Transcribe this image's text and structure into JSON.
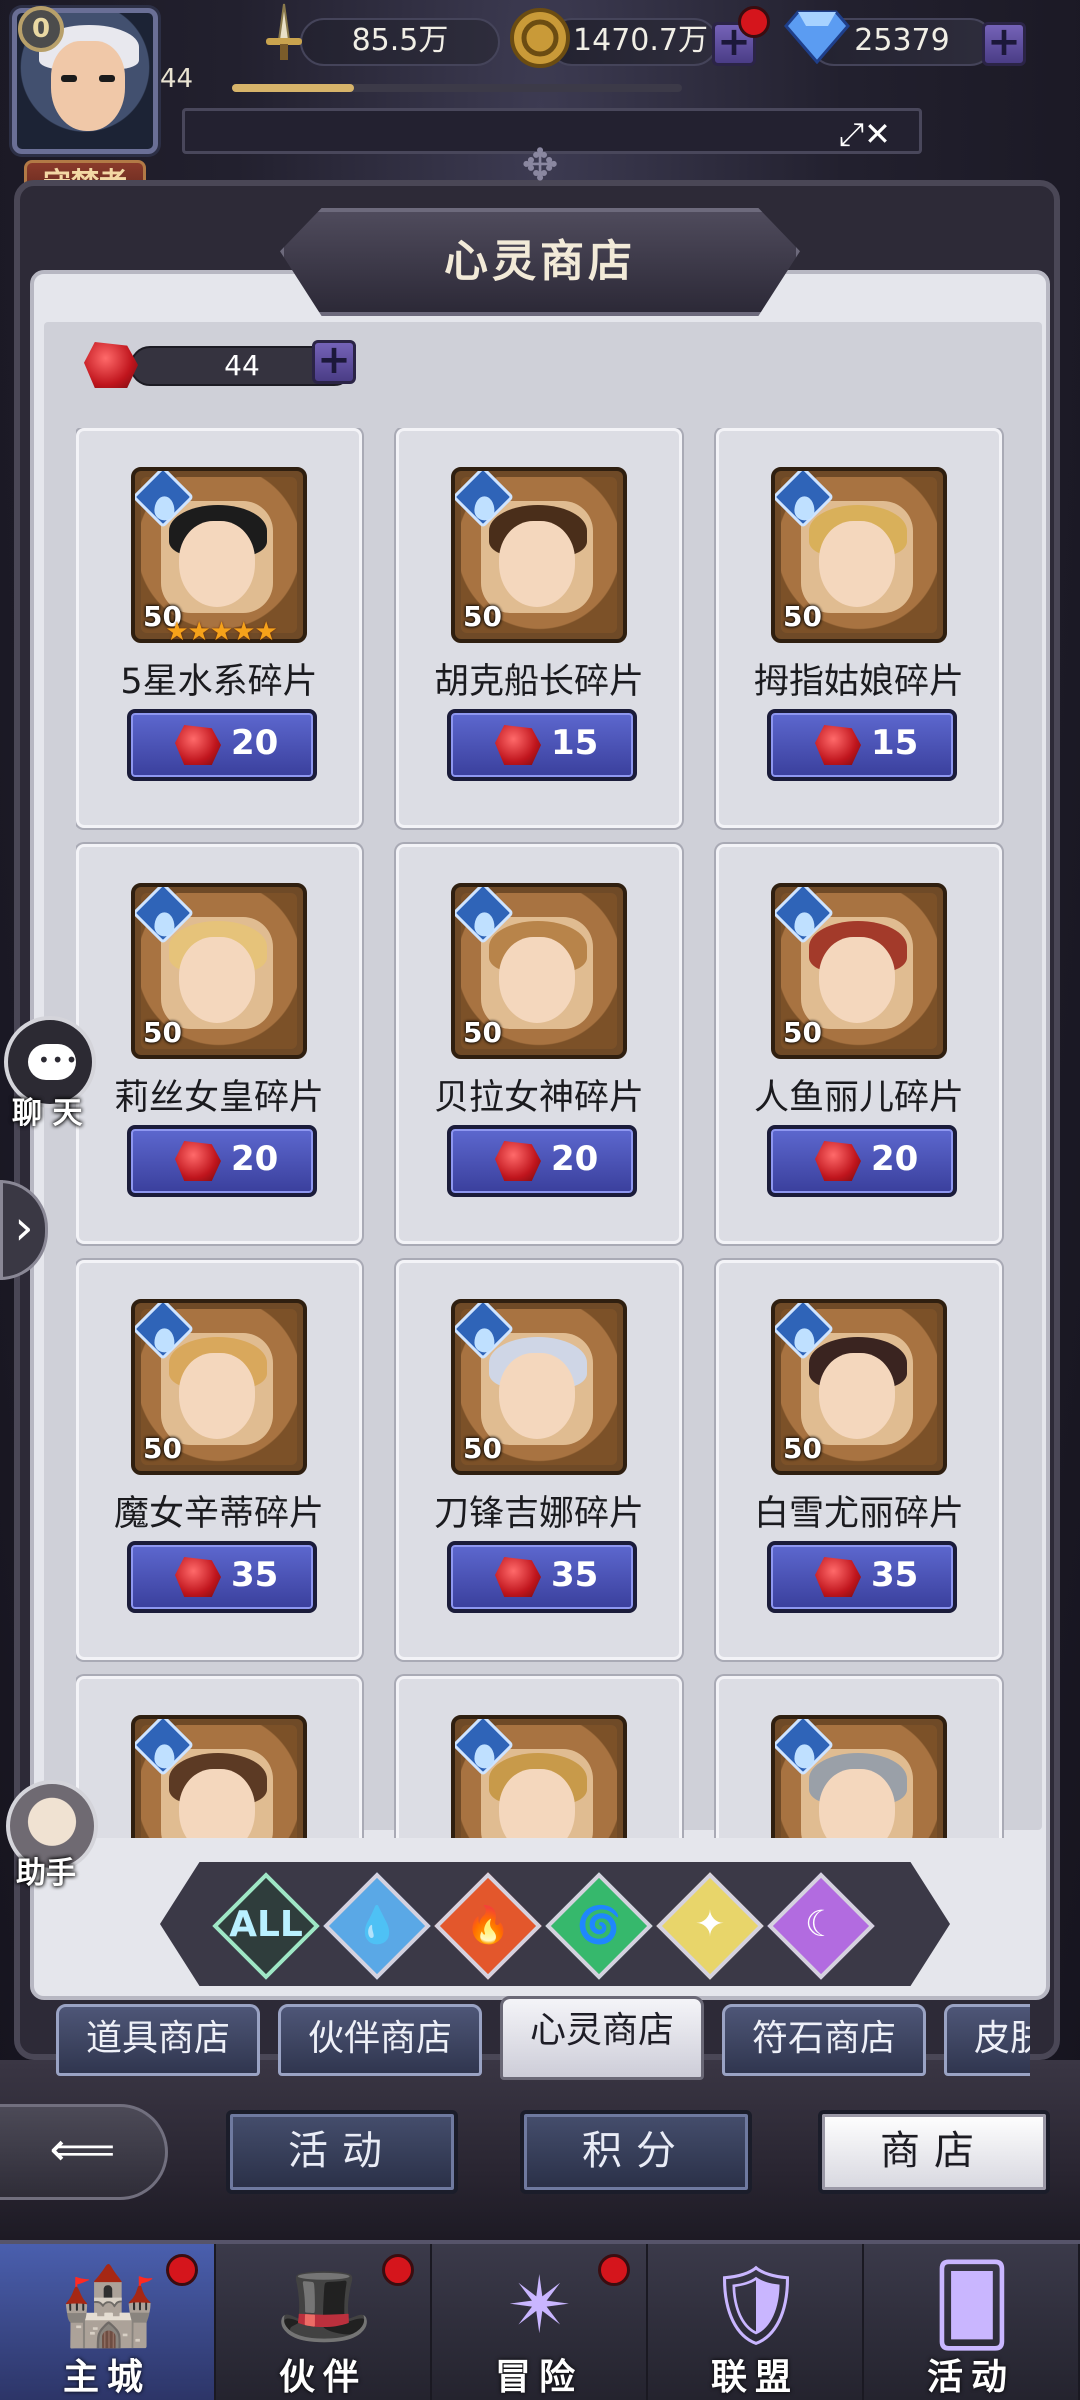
{
  "player": {
    "vip_level": "0",
    "level": "44",
    "title_badge": "守梦者",
    "xp_progress": 0.27
  },
  "resources": {
    "power": "85.5万",
    "gold": "1470.7万",
    "diamonds": "25379",
    "power_icon": "sword-icon",
    "gold_icon": "gold-coin-icon",
    "diamond_icon": "diamond-icon"
  },
  "notice": {
    "icon": "fullscreen-toggle-icon"
  },
  "shop": {
    "title": "心灵商店",
    "currency_amount": "44",
    "currency_icon": "red-crystal-icon"
  },
  "items": [
    {
      "name": "5星水系碎片",
      "level": "50",
      "price": "20",
      "stars": "★★★★★"
    },
    {
      "name": "胡克船长碎片",
      "level": "50",
      "price": "15",
      "stars": ""
    },
    {
      "name": "拇指姑娘碎片",
      "level": "50",
      "price": "15",
      "stars": ""
    },
    {
      "name": "莉丝女皇碎片",
      "level": "50",
      "price": "20",
      "stars": ""
    },
    {
      "name": "贝拉女神碎片",
      "level": "50",
      "price": "20",
      "stars": ""
    },
    {
      "name": "人鱼丽儿碎片",
      "level": "50",
      "price": "20",
      "stars": ""
    },
    {
      "name": "魔女辛蒂碎片",
      "level": "50",
      "price": "35",
      "stars": ""
    },
    {
      "name": "刀锋吉娜碎片",
      "level": "50",
      "price": "35",
      "stars": ""
    },
    {
      "name": "白雪尤丽碎片",
      "level": "50",
      "price": "35",
      "stars": ""
    },
    {
      "name": "",
      "level": "",
      "price": "",
      "stars": ""
    },
    {
      "name": "",
      "level": "",
      "price": "",
      "stars": ""
    },
    {
      "name": "",
      "level": "",
      "price": "",
      "stars": ""
    }
  ],
  "side": {
    "chat_label": "聊 天",
    "assistant_label": "助手",
    "expand_icon": "chevron-right-icon"
  },
  "filters": [
    {
      "label": "ALL",
      "color": "#9fe7c6"
    },
    {
      "label": "💧",
      "color": "#5aa8e6"
    },
    {
      "label": "🔥",
      "color": "#e3572c"
    },
    {
      "label": "🌀",
      "color": "#36b86c"
    },
    {
      "label": "✦",
      "color": "#e8d56a"
    },
    {
      "label": "☾",
      "color": "#b26be0"
    }
  ],
  "tabs": [
    "道具商店",
    "伙伴商店",
    "心灵商店",
    "符石商店",
    "皮肤商店"
  ],
  "active_tab": 2,
  "subnav": {
    "back_icon": "back-arrow-icon",
    "buttons": [
      "活动",
      "积分",
      "商店"
    ],
    "active": 2
  },
  "bottom_nav": [
    {
      "label": "主城",
      "icon": "castle-icon",
      "badge": true
    },
    {
      "label": "伙伴",
      "icon": "witch-hat-icon",
      "badge": true
    },
    {
      "label": "冒险",
      "icon": "compass-icon",
      "badge": true
    },
    {
      "label": "联盟",
      "icon": "shield-icon",
      "badge": false
    },
    {
      "label": "活动",
      "icon": "cards-icon",
      "badge": false
    }
  ],
  "colors": {
    "accent_blue": "#4a54b8",
    "red_dot": "#d5151c",
    "star": "#f6a21a"
  }
}
